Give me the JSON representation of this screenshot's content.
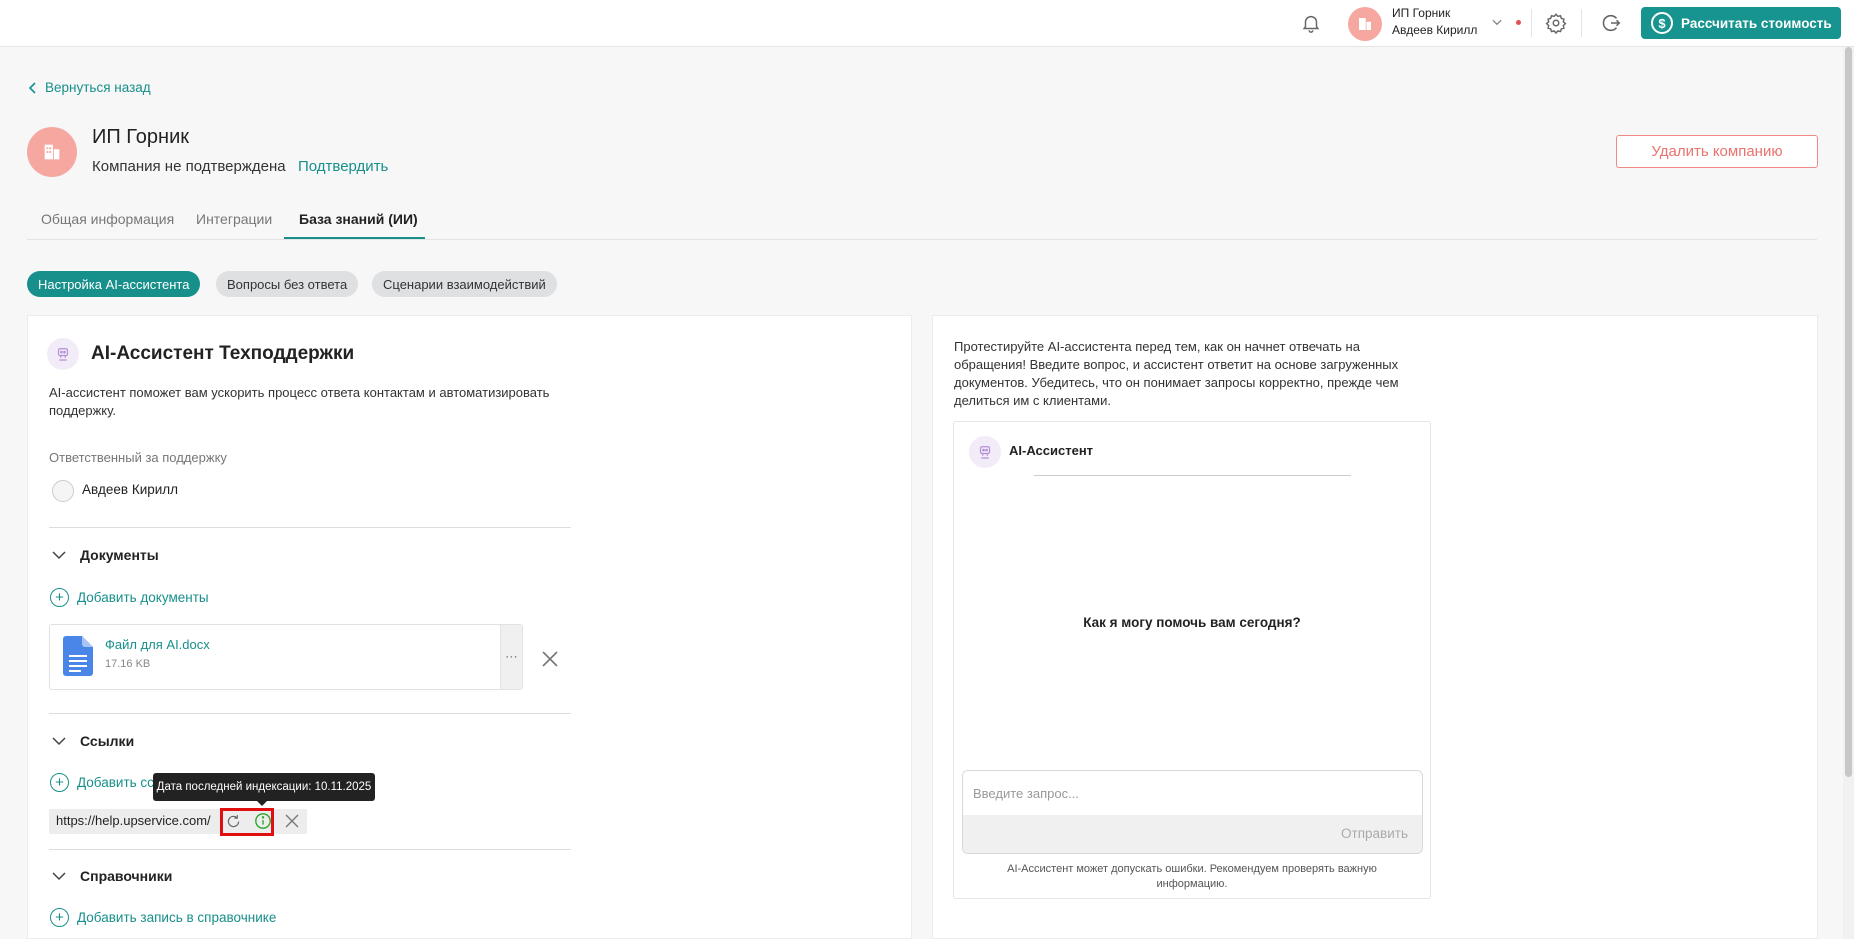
{
  "header": {
    "company": "ИП Горник",
    "user": "Авдеев Кирилл",
    "calc_button": "Рассчитать стоимость",
    "calc_symbol": "$"
  },
  "page": {
    "back_label": "Вернуться назад",
    "company_name": "ИП Горник",
    "company_status": "Компания не подтверждена",
    "confirm_link": "Подтвердить",
    "delete_button": "Удалить компанию"
  },
  "tabs": [
    {
      "label": "Общая информация"
    },
    {
      "label": "Интеграции"
    },
    {
      "label": "База знаний (ИИ)",
      "active": true
    }
  ],
  "chips": [
    {
      "label": "Настройка AI-ассистента",
      "active": true
    },
    {
      "label": "Вопросы без ответа"
    },
    {
      "label": "Сценарии взаимодействий"
    }
  ],
  "assistant": {
    "title": "AI-Ассистент Техподдержки",
    "description": "AI-ассистент поможет вам ускорить процесс ответа контактам и автоматизировать поддержку.",
    "responsible_label": "Ответственный за поддержку",
    "responsible_name": "Авдеев Кирилл"
  },
  "documents": {
    "title": "Документы",
    "add_label": "Добавить документы",
    "files": [
      {
        "name": "Файл для AI.docx",
        "size": "17.16 KB"
      }
    ],
    "menu_symbol": "⋯"
  },
  "links": {
    "title": "Ссылки",
    "add_label": "Добавить ссылку",
    "items": [
      {
        "url": "https://help.upservice.com/"
      }
    ],
    "tooltip": "Дата последней индексации: 10.11.2025"
  },
  "references": {
    "title": "Справочники",
    "add_label": "Добавить запись в справочнике"
  },
  "test": {
    "description": "Протестируйте AI-ассистента перед тем, как он начнет отвечать на обращения! Введите вопрос, и ассистент ответит на основе загруженных документов. Убедитесь, что он понимает запросы корректно, прежде чем делиться им с клиентами.",
    "chat_title": "AI-Ассистент",
    "prompt": "Как я могу помочь вам сегодня?",
    "input_placeholder": "Введите запрос...",
    "send_label": "Отправить",
    "disclaimer": "AI-Ассистент может допускать ошибки. Рекомендуем проверять важную информацию."
  },
  "colors": {
    "accent": "#178f8a",
    "danger": "#e9736d",
    "avatar": "#f6a7a0"
  }
}
